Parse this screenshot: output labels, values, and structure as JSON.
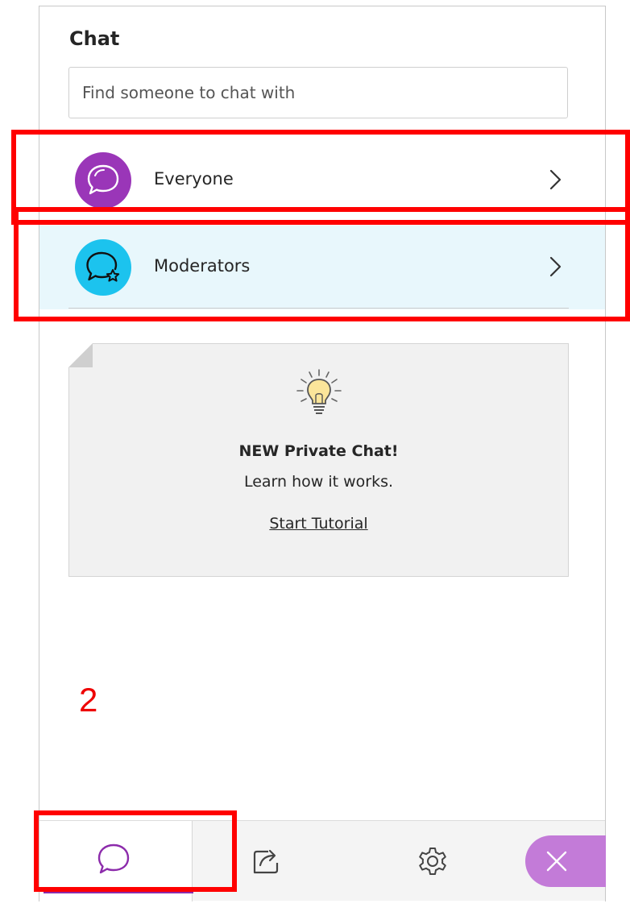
{
  "panel": {
    "title": "Chat",
    "search": {
      "placeholder": "Find someone to chat with"
    }
  },
  "chats": [
    {
      "label": "Everyone",
      "avatar_icon": "chat-bubble-icon",
      "avatar_color": "#9a36b8"
    },
    {
      "label": "Moderators",
      "avatar_icon": "chat-bubble-star-icon",
      "avatar_color": "#1cc3ee"
    }
  ],
  "tip": {
    "icon": "lightbulb-icon",
    "title": "NEW Private Chat!",
    "subtitle": "Learn how it works.",
    "link": "Start Tutorial"
  },
  "annotation": {
    "step": "2",
    "color": "#ff0000"
  },
  "toolbar": {
    "items": [
      {
        "name": "chat",
        "icon": "chat-bubble-icon",
        "active": true
      },
      {
        "name": "share",
        "icon": "share-content-icon"
      },
      {
        "name": "settings",
        "icon": "gear-icon"
      },
      {
        "name": "close",
        "icon": "close-icon"
      }
    ],
    "accent": "#8c2bab"
  }
}
